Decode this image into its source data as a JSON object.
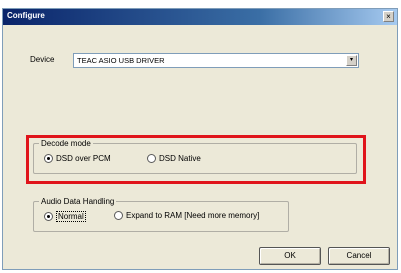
{
  "window": {
    "title": "Configure",
    "close_glyph": "×"
  },
  "device": {
    "label": "Device",
    "selected": "TEAC ASIO USB DRIVER",
    "arrow_glyph": "▾"
  },
  "decode_mode": {
    "legend": "Decode mode",
    "options": [
      {
        "label": "DSD over PCM",
        "checked": true
      },
      {
        "label": "DSD Native",
        "checked": false
      }
    ]
  },
  "audio_data_handling": {
    "legend": "Audio Data Handling",
    "options": [
      {
        "label": "Normal",
        "checked": true
      },
      {
        "label": "Expand to RAM [Need more memory]",
        "checked": false
      }
    ]
  },
  "buttons": {
    "ok": "OK",
    "cancel": "Cancel"
  },
  "colors": {
    "highlight": "#e0141b",
    "titlebar": "#0a246a",
    "dialog_bg": "#ece9d8"
  }
}
